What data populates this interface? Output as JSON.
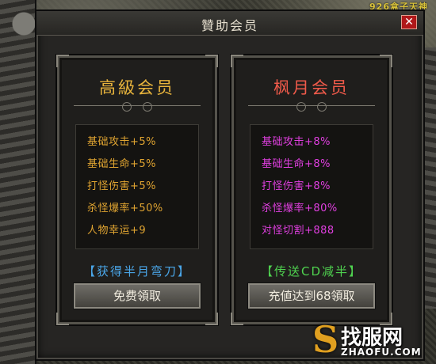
{
  "banner": {
    "text": "926盒子天神"
  },
  "dialog": {
    "title": "贊助会员",
    "close_label": "✕"
  },
  "cards": [
    {
      "title": "高級会员",
      "stats": [
        "基础攻击+5%",
        "基础生命+5%",
        "打怪伤害+5%",
        "杀怪爆率+50%",
        "人物幸运+9"
      ],
      "reward": "【获得半月弯刀】",
      "button": "免费領取"
    },
    {
      "title": "枫月会员",
      "stats": [
        "基础攻击+8%",
        "基础生命+8%",
        "打怪伤害+8%",
        "杀怪爆率+80%",
        "对怪切割+888"
      ],
      "reward": "【传送CD减半】",
      "button": "充値达到68領取"
    }
  ],
  "watermark": {
    "logo": "S",
    "name": "找服网",
    "url": "ZHAOFU.COM"
  },
  "colors": {
    "gold": "#e0a431",
    "magenta": "#e03fe0",
    "blue_reward": "#4aa6e8",
    "green_reward": "#4fd24f",
    "close_red": "#b0181a"
  }
}
